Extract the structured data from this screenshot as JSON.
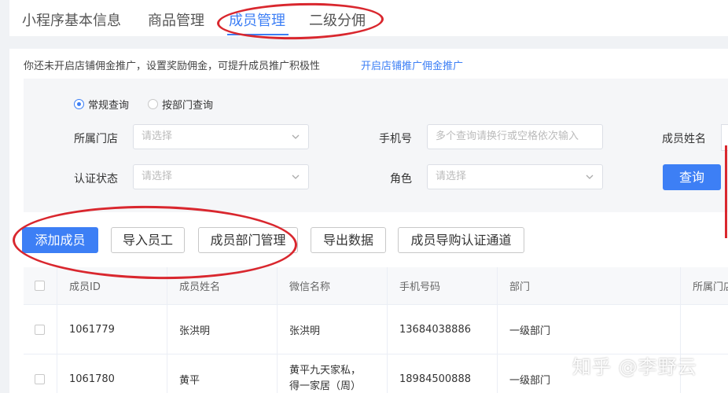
{
  "tabs": [
    "小程序基本信息",
    "商品管理",
    "成员管理",
    "二级分佣"
  ],
  "notice": {
    "text": "你还未开启店铺佣金推广，设置奖励佣金，可提升成员推广积极性",
    "link": "开启店铺推广佣金推广"
  },
  "filter": {
    "radio_normal": "常规查询",
    "radio_dept": "按部门查询",
    "store_label": "所属门店",
    "store_placeholder": "请选择",
    "phone_label": "手机号",
    "phone_placeholder": "多个查询请换行或空格依次输入",
    "name_label": "成员姓名",
    "cert_label": "认证状态",
    "cert_placeholder": "请选择",
    "role_label": "角色",
    "role_placeholder": "请选择",
    "query_button": "查询"
  },
  "actions": {
    "add_member": "添加成员",
    "import_staff": "导入员工",
    "dept_manage": "成员部门管理",
    "export_data": "导出数据",
    "guide_cert": "成员导购认证通道"
  },
  "table": {
    "headers": [
      "成员ID",
      "成员姓名",
      "微信名称",
      "手机号码",
      "部门",
      "所属门店"
    ],
    "rows": [
      {
        "id": "1061779",
        "name": "张洪明",
        "wechat_line1": "张洪明",
        "wechat_line2": "",
        "phone": "13684038886",
        "dept": "一级部门"
      },
      {
        "id": "1061780",
        "name": "黄平",
        "wechat_line1": "黄平九天家私，",
        "wechat_line2": "得一家居（周）",
        "phone": "18984500888",
        "dept": "一级部门"
      }
    ]
  },
  "watermark": "知乎 @李野云",
  "colors": {
    "accent": "#3d7ff5",
    "annotation": "#d9272e"
  }
}
